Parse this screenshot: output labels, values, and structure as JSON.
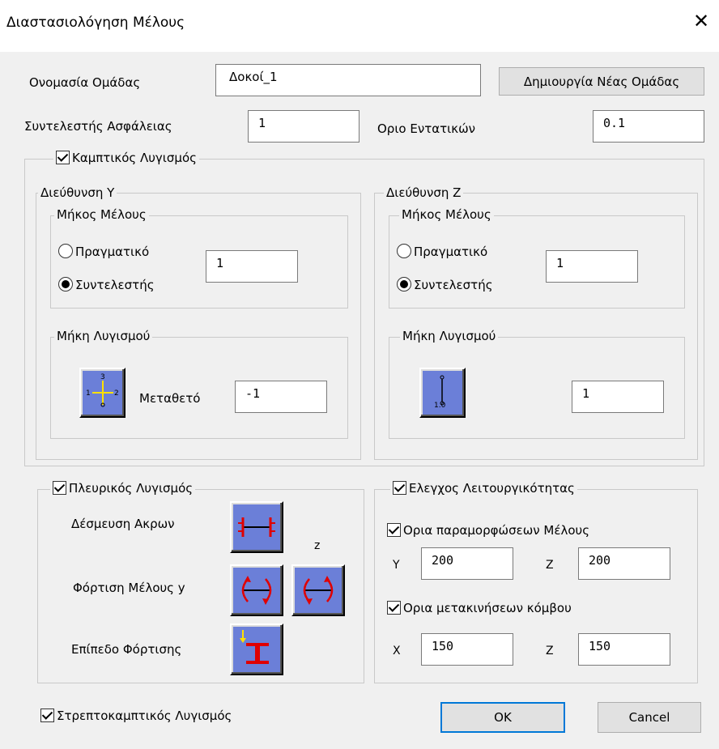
{
  "window": {
    "title": "Διαστασιολόγηση Μέλους",
    "close_glyph": "✕"
  },
  "group_name": {
    "label": "Ονομασία Ομάδας",
    "value": "Δοκοί_1",
    "create_button": "Δημιουργία Νέας Ομάδας"
  },
  "safety_factor": {
    "label": "Συντελεστής Ασφάλειας",
    "value": "1"
  },
  "stress_limit": {
    "label": "Οριο Εντατικών",
    "value": "0.1"
  },
  "flexural": {
    "label": "Καμπτικός Λυγισμός",
    "checked": true,
    "dir_y": {
      "label": "Διεύθυνση Υ",
      "member_length": {
        "label": "Μήκος Μέλους",
        "opt_actual": "Πραγματικό",
        "opt_factor": "Συντελεστής",
        "selected": "factor",
        "value": "1"
      },
      "buckling": {
        "label": "Μήκη Λυγισμού",
        "type_label": "Μεταθετό",
        "value": "-1",
        "icon": "sway-frame-icon"
      }
    },
    "dir_z": {
      "label": "Διεύθυνση Ζ",
      "member_length": {
        "label": "Μήκος Μέλους",
        "opt_actual": "Πραγματικό",
        "opt_factor": "Συντελεστής",
        "selected": "factor",
        "value": "1"
      },
      "buckling": {
        "label": "Μήκη Λυγισμού",
        "icon_text": "1.0",
        "value": "1",
        "icon": "buckling-length-icon"
      }
    }
  },
  "lateral": {
    "label": "Πλευρικός Λυγισμός",
    "checked": true,
    "end_restraint": "Δέσμευση Ακρων",
    "member_loading": "Φόρτιση Μέλους y",
    "z_label": "z",
    "load_level": "Επίπεδο Φόρτισης"
  },
  "serviceability": {
    "label": "Ελεγχος Λειτουργικότητας",
    "checked": true,
    "deformation": {
      "label": "Ορια παραμορφώσεων Μέλους",
      "checked": true,
      "y_label": "Y",
      "y_value": "200",
      "z_label": "Z",
      "z_value": "200"
    },
    "displacement": {
      "label": "Ορια μετακινήσεων κόμβου",
      "checked": true,
      "x_label": "X",
      "x_value": "150",
      "z_label": "Z",
      "z_value": "150"
    }
  },
  "torsional": {
    "label": "Στρεπτοκαμπτικός  Λυγισμός",
    "checked": true
  },
  "buttons": {
    "ok": "OK",
    "cancel": "Cancel"
  },
  "colors": {
    "icon_bg": "#6b7fd8",
    "icon_red": "#e00000",
    "icon_yellow": "#ffe000",
    "ok_border": "#0078d7"
  }
}
